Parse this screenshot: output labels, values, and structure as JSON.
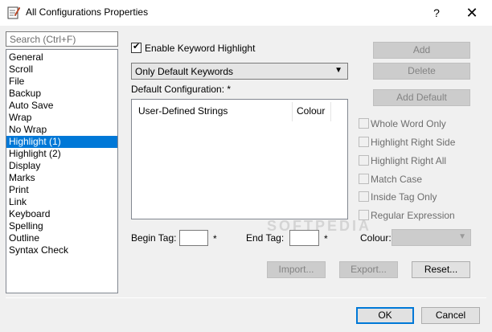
{
  "window": {
    "title": "All Configurations Properties",
    "help_label": "?",
    "close_label": "✕"
  },
  "search": {
    "placeholder": "Search (Ctrl+F)"
  },
  "categories": [
    "General",
    "Scroll",
    "File",
    "Backup",
    "Auto Save",
    "Wrap",
    "No Wrap",
    "Highlight (1)",
    "Highlight (2)",
    "Display",
    "Marks",
    "Print",
    "Link",
    "Keyboard",
    "Spelling",
    "Outline",
    "Syntax Check"
  ],
  "selected_category": "Highlight (1)",
  "highlight": {
    "enable_label": "Enable Keyword Highlight",
    "enable_checked": true,
    "keywords_select": "Only Default Keywords",
    "default_config_label": "Default Configuration: *",
    "columns": [
      "User-Defined Strings",
      "Colour"
    ]
  },
  "buttons": {
    "add": "Add",
    "delete": "Delete",
    "add_default": "Add Default",
    "import": "Import...",
    "export": "Export...",
    "reset": "Reset...",
    "ok": "OK",
    "cancel": "Cancel"
  },
  "options": {
    "whole_word_only": "Whole Word Only",
    "highlight_right_side": "Highlight Right Side",
    "highlight_right_all": "Highlight Right All",
    "match_case": "Match Case",
    "inside_tag_only": "Inside Tag Only",
    "regular_expression": "Regular Expression"
  },
  "tags": {
    "begin_label": "Begin Tag:",
    "end_label": "End Tag:",
    "star": "*",
    "colour_label": "Colour:"
  },
  "watermark": "SOFTPEDIA"
}
